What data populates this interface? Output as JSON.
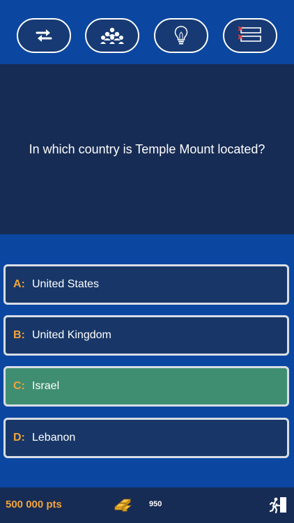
{
  "question": {
    "text": "In which country is Temple Mount located?"
  },
  "answers": [
    {
      "letter": "A:",
      "text": "United States",
      "state": "normal"
    },
    {
      "letter": "B:",
      "text": "United Kingdom",
      "state": "normal"
    },
    {
      "letter": "C:",
      "text": "Israel",
      "state": "correct"
    },
    {
      "letter": "D:",
      "text": "Lebanon",
      "state": "normal"
    }
  ],
  "lifelines": [
    {
      "icon": "swap-arrows-icon"
    },
    {
      "icon": "audience-icon"
    },
    {
      "icon": "lightbulb-icon"
    },
    {
      "icon": "fifty-fifty-list-icon"
    }
  ],
  "footer": {
    "points": "500 000 pts",
    "coins": "950",
    "coins_icon": "gold-bars-icon",
    "exit_icon": "exit-door-icon"
  },
  "colors": {
    "background": "#0b47a0",
    "panel": "#172c54",
    "answer": "#183768",
    "correct": "#3f8e72",
    "accent": "#f1a43a"
  }
}
